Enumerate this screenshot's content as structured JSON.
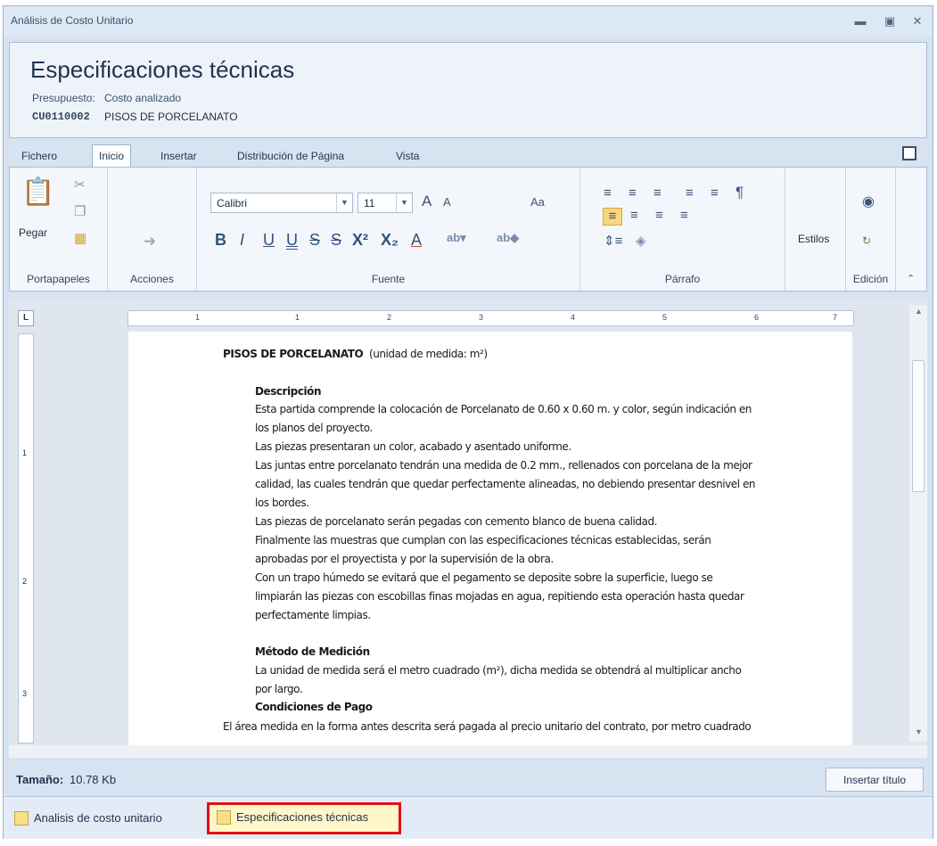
{
  "window": {
    "title": "Análisis de Costo Unitario"
  },
  "header": {
    "title": "Especificaciones técnicas",
    "presupuesto_label": "Presupuesto:",
    "costo_label": "Costo analizado",
    "code": "CU0110002",
    "item_name": "PISOS DE PORCELANATO"
  },
  "tabs": [
    {
      "label": "Fichero"
    },
    {
      "label": "Inicio"
    },
    {
      "label": "Insertar"
    },
    {
      "label": "Distribución de Página"
    },
    {
      "label": "Vista"
    }
  ],
  "ribbon": {
    "portapapeles": {
      "label": "Portapapeles",
      "paste": "Pegar"
    },
    "acciones": {
      "label": "Acciones"
    },
    "fuente": {
      "label": "Fuente",
      "font": "Calibri",
      "size": "11",
      "grow": "A",
      "shrink": "A",
      "case": "Aa"
    },
    "parrafo": {
      "label": "Párrafo"
    },
    "estilos": {
      "label": "Estilos"
    },
    "edicion": {
      "label": "Edición"
    }
  },
  "ruler_numbers": [
    "1",
    "1",
    "2",
    "3",
    "4",
    "5",
    "6",
    "7"
  ],
  "vruler_numbers": [
    "1",
    "2",
    "3"
  ],
  "document": {
    "heading": "PISOS DE PORCELANATO",
    "unit": "(unidad de medida: m²)",
    "desc_title": "Descripción",
    "desc_lines": [
      "Esta partida comprende la colocación de Porcelanato de 0.60 x 0.60 m. y color, según indicación en",
      "los planos del proyecto.",
      "Las piezas presentaran un color, acabado y asentado uniforme.",
      "Las juntas entre porcelanato tendrán una medida de 0.2 mm., rellenados con porcelana de la mejor",
      "calidad, las cuales tendrán que quedar perfectamente alineadas, no debiendo presentar desnivel en",
      "los bordes.",
      "Las piezas de porcelanato serán pegadas con cemento blanco de buena calidad.",
      "Finalmente las muestras que cumplan con las especificaciones técnicas establecidas, serán",
      "aprobadas por el proyectista y por la supervisión de la obra.",
      "Con un trapo húmedo se evitará que el pegamento se deposite sobre la superficie, luego se",
      "limpiarán las piezas con escobillas finas mojadas en agua, repitiendo esta operación hasta quedar",
      "perfectamente limpias."
    ],
    "metodo_title": "Método de Medición",
    "metodo_lines": [
      "La unidad de medida será el metro cuadrado (m²), dicha medida se obtendrá al multiplicar ancho",
      "por largo."
    ],
    "pago_title": "Condiciones de Pago",
    "pago_cut": "El área medida en la forma antes descrita será pagada al precio unitario del contrato, por metro cuadrado"
  },
  "status": {
    "size_label": "Tamaño:",
    "size_value": "10.78 Kb",
    "insert_title": "Insertar título"
  },
  "bottom_tabs": [
    {
      "label": "Analisis de costo unitario"
    },
    {
      "label": "Especificaciones técnicas"
    }
  ],
  "colors": {
    "accent_highlight": "#e01111",
    "window_bg": "#d7e3f1",
    "ribbon_bg": "#f3f7fc"
  },
  "icons": [
    "paste-icon",
    "cut-icon",
    "copy-icon",
    "redo-icon",
    "bullets-icon",
    "align-left-icon",
    "pilcrow-icon",
    "find-icon",
    "replace-icon",
    "save-icon"
  ]
}
